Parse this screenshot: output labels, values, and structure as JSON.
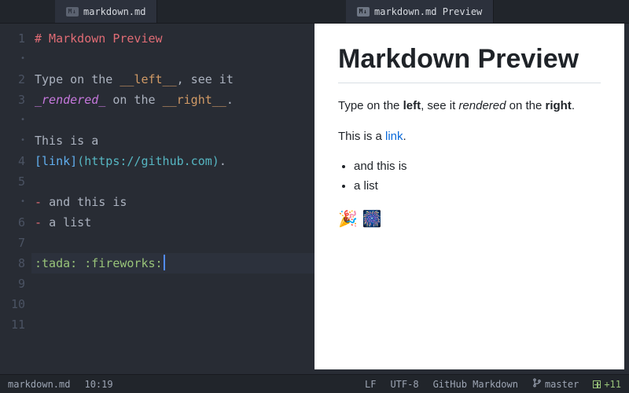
{
  "tabs": {
    "editor": "markdown.md",
    "preview": "markdown.md Preview"
  },
  "editor": {
    "gutter_marks": [
      "1",
      "•",
      "2",
      "3",
      "•",
      "•",
      "4",
      "5",
      "•",
      "6",
      "7",
      "8",
      "9",
      "10",
      "11"
    ],
    "cursor_line_index": 13,
    "line1_heading": "# Markdown Preview",
    "line3_a": "Type on the ",
    "line3_b": "__left__",
    "line3_c": ", see it",
    "line4_a": "_rendered_",
    "line4_b": " on the ",
    "line4_c": "__right__",
    "line4_d": ".",
    "line6_a": "This is a",
    "line7_a": "[link]",
    "line7_b": "(https://github.com)",
    "line7_c": ".",
    "line9_bullet": "- ",
    "line9_text": "and this is",
    "line10_bullet": "- ",
    "line10_text": "a list",
    "line12_a": ":tada:",
    "line12_sp": " ",
    "line12_b": ":fireworks:"
  },
  "preview": {
    "h1": "Markdown Preview",
    "p1_a": "Type on the ",
    "p1_b": "left",
    "p1_c": ", see it ",
    "p1_d": "rendered",
    "p1_e": " on the ",
    "p1_f": "right",
    "p1_g": ".",
    "p2_a": "This is a ",
    "p2_link": "link",
    "p2_b": ".",
    "li1": "and this is",
    "li2": "a list",
    "emoji": "🎉 🎆"
  },
  "status": {
    "filename": "markdown.md",
    "cursor": "10:19",
    "eol": "LF",
    "encoding": "UTF-8",
    "grammar": "GitHub Markdown",
    "branch": "master",
    "diff": "+11"
  }
}
